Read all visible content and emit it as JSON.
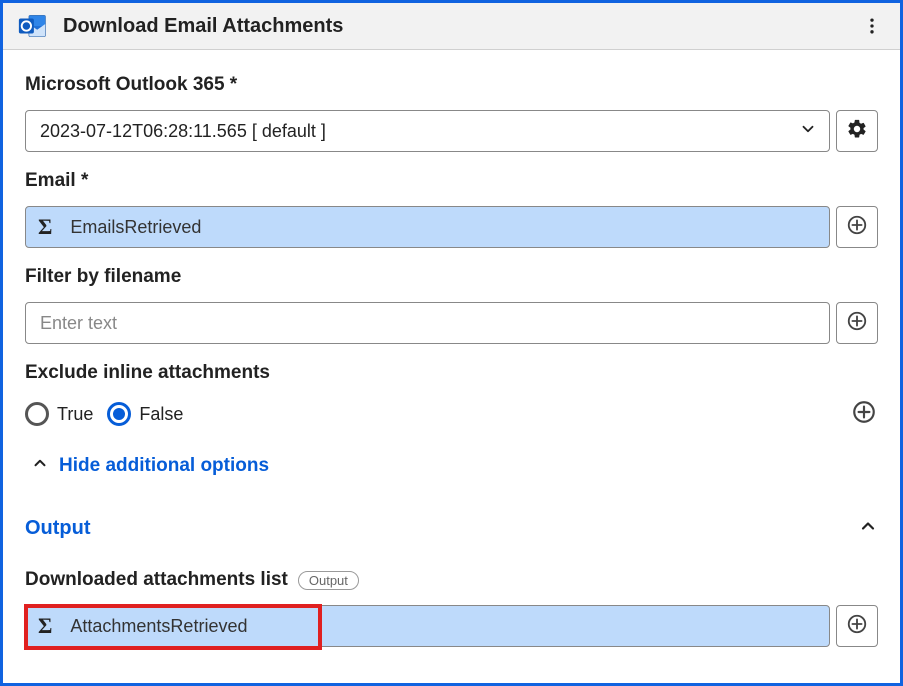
{
  "header": {
    "title": "Download Email Attachments"
  },
  "fields": {
    "connection": {
      "label": "Microsoft Outlook 365 *",
      "value": "2023-07-12T06:28:11.565 [ default ]"
    },
    "email": {
      "label": "Email *",
      "value": "EmailsRetrieved"
    },
    "filter": {
      "label": "Filter by filename",
      "placeholder": "Enter text"
    },
    "exclude": {
      "label": "Exclude inline attachments",
      "options": {
        "true": "True",
        "false": "False"
      },
      "selected": "false"
    },
    "toggle": {
      "label": "Hide additional options"
    },
    "output_section": {
      "label": "Output"
    },
    "downloaded": {
      "label": "Downloaded attachments list",
      "pill": "Output",
      "value": "AttachmentsRetrieved"
    }
  }
}
